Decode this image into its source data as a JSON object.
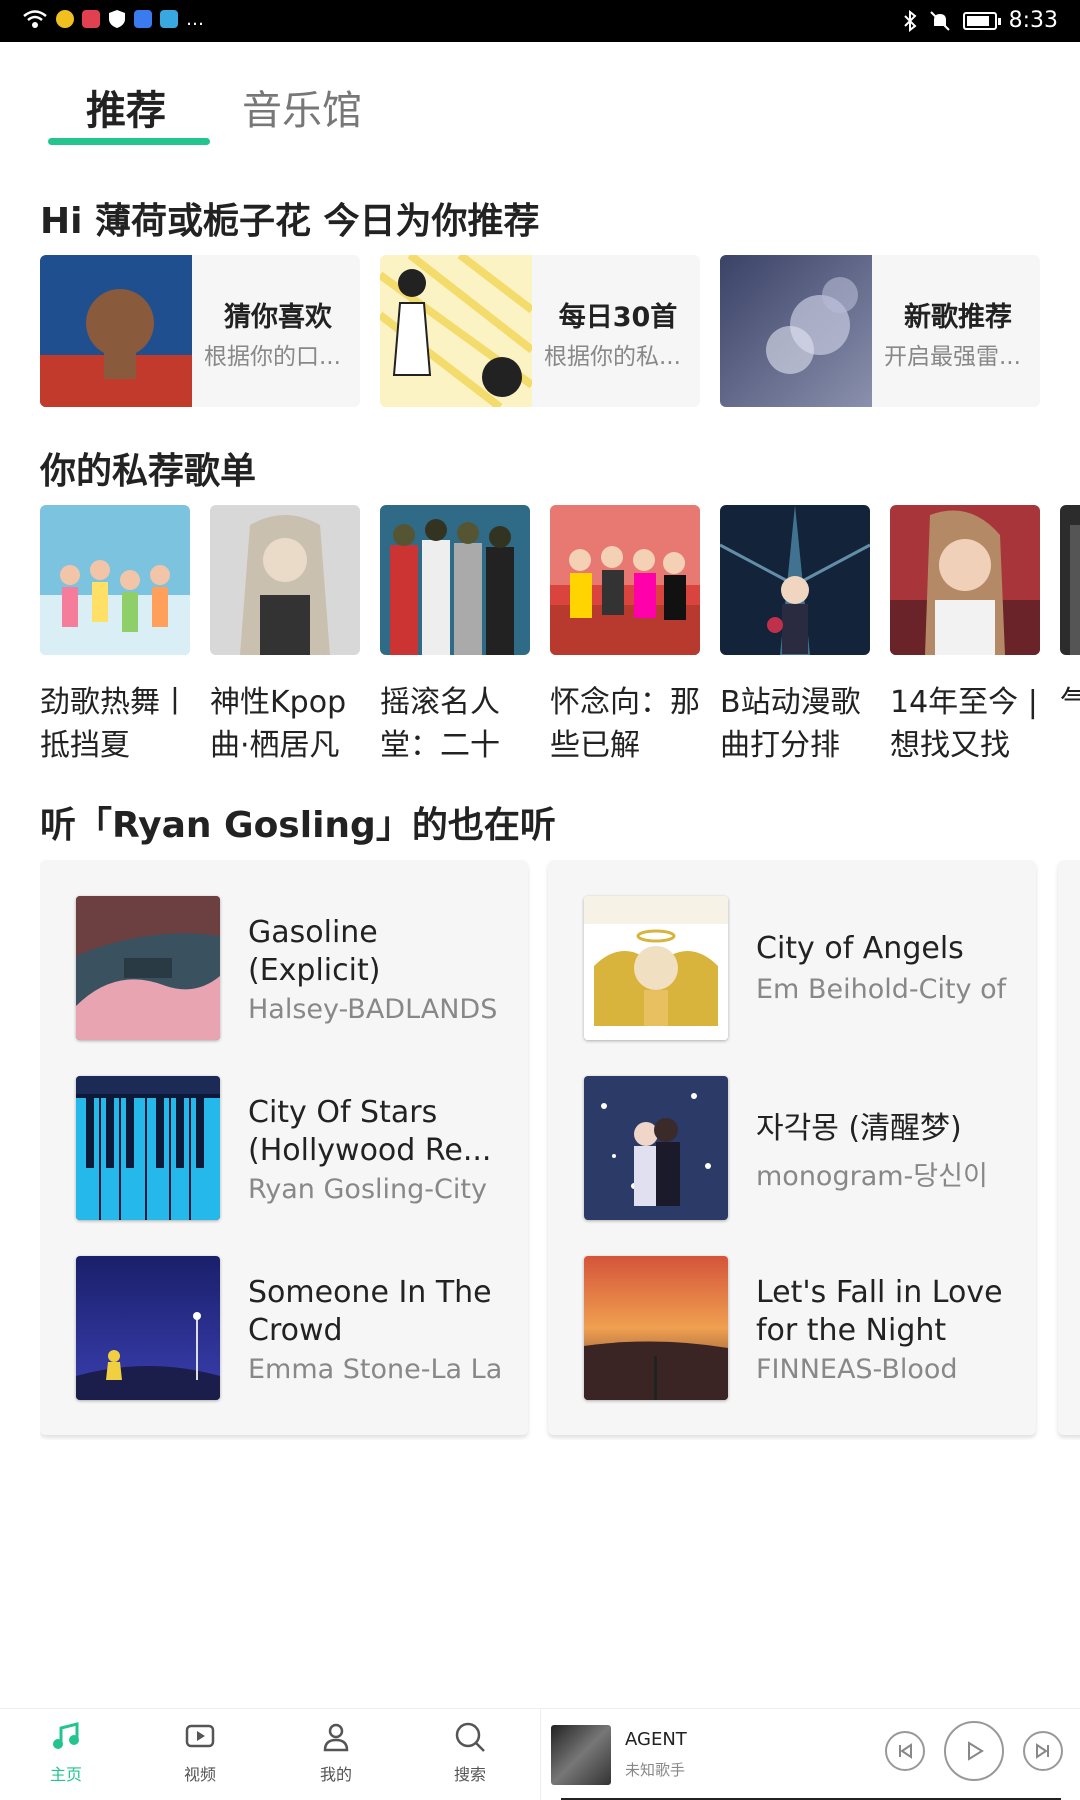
{
  "status_bar": {
    "time": "8:33",
    "battery_level": 0.85,
    "icons": [
      "wifi-icon",
      "app-icon",
      "app-icon",
      "shield-icon",
      "app-icon",
      "app-icon",
      "more-icon",
      "bluetooth-icon",
      "mute-icon",
      "battery-icon"
    ]
  },
  "tabs": [
    {
      "label": "推荐",
      "active": true
    },
    {
      "label": "音乐馆",
      "active": false
    }
  ],
  "greeting_title": "Hi 薄荷或栀子花  今日为你推荐",
  "recommend_cards": [
    {
      "title": "猜你喜欢",
      "subtitle": "根据你的口..."
    },
    {
      "title": "每日30首",
      "subtitle": "根据你的私..."
    },
    {
      "title": "新歌推荐",
      "subtitle": "开启最强雷..."
    }
  ],
  "private_playlists_title": "你的私荐歌单",
  "private_playlists": [
    {
      "name": "劲歌热舞丨抵挡夏"
    },
    {
      "name": "神性Kpop曲·栖居凡"
    },
    {
      "name": "摇滚名人堂：二十"
    },
    {
      "name": "怀念向：那些已解"
    },
    {
      "name": "B站动漫歌曲打分排"
    },
    {
      "name": "14年至今 | 想找又找"
    },
    {
      "name": "气磺"
    }
  ],
  "also_listening_title": "听「Ryan Gosling」的也在听",
  "also_listening_columns": [
    [
      {
        "title": "Gasoline (Explicit)",
        "artist": "Halsey-BADLANDS"
      },
      {
        "title": "City Of Stars (Hollywood Re...",
        "artist": "Ryan Gosling-City"
      },
      {
        "title": "Someone In The Crowd",
        "artist": "Emma Stone-La La"
      }
    ],
    [
      {
        "title": "City of Angels",
        "artist": "Em Beihold-City of"
      },
      {
        "title": "자각몽 (清醒梦)",
        "artist": "monogram-당신이"
      },
      {
        "title": "Let's Fall in Love for the Night (E...",
        "artist": "FINNEAS-Blood"
      }
    ]
  ],
  "bottom_nav": [
    {
      "label": "主页",
      "icon": "music-note-icon",
      "active": true
    },
    {
      "label": "视频",
      "icon": "video-icon",
      "active": false
    },
    {
      "label": "我的",
      "icon": "person-icon",
      "active": false
    },
    {
      "label": "搜索",
      "icon": "search-icon",
      "active": false
    }
  ],
  "now_playing": {
    "title": "AGENT",
    "artist": "未知歌手"
  },
  "colors": {
    "accent": "#23c48d",
    "card_bg": "#f6f6f6",
    "text": "#222222",
    "secondary_text": "#888888"
  }
}
